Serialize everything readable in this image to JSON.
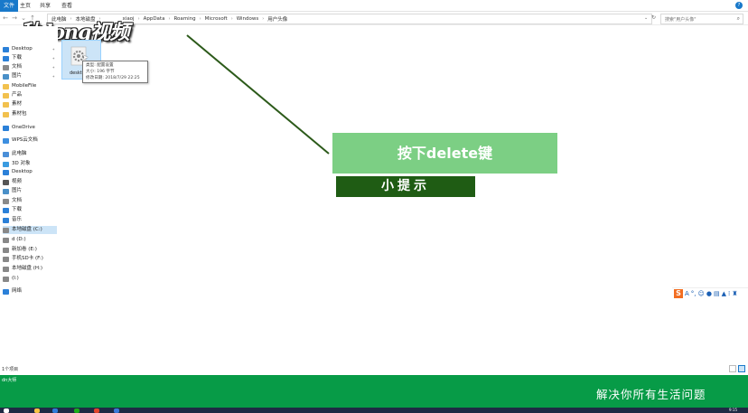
{
  "ribbon": {
    "tabs": [
      {
        "label": "文件",
        "active": true
      },
      {
        "label": "主页",
        "active": false
      },
      {
        "label": "共享",
        "active": false
      },
      {
        "label": "查看",
        "active": false
      }
    ],
    "help_glyph": "?"
  },
  "address": {
    "crumbs": [
      "本地磁盘",
      "xiaoj",
      "AppData",
      "Roaming",
      "Microsoft",
      "Windows",
      "用户头像"
    ],
    "leading_crumb": "此电脑",
    "search_placeholder": "搜索\"用户头像\""
  },
  "logo_text": "秋dong视频",
  "nav": {
    "items": [
      {
        "label": "Desktop",
        "icon": "desktop-icon",
        "pinned": true
      },
      {
        "label": "下载",
        "icon": "download-icon",
        "pinned": true
      },
      {
        "label": "文档",
        "icon": "document-icon",
        "pinned": true
      },
      {
        "label": "图片",
        "icon": "pictures-icon",
        "pinned": true
      },
      {
        "label": "MobileFile",
        "icon": "folder-icon",
        "pinned": false
      },
      {
        "label": "产品",
        "icon": "folder-icon",
        "pinned": false
      },
      {
        "label": "素材",
        "icon": "folder-icon",
        "pinned": false
      },
      {
        "label": "素材包",
        "icon": "folder-icon",
        "pinned": false
      },
      {
        "label": "OneDrive",
        "icon": "onedrive-icon",
        "pinned": false
      },
      {
        "label": "WPS云文档",
        "icon": "cloud-icon",
        "pinned": false
      },
      {
        "label": "此电脑",
        "icon": "computer-icon",
        "pinned": false
      },
      {
        "label": "3D 对象",
        "icon": "3d-objects-icon",
        "pinned": false
      },
      {
        "label": "Desktop",
        "icon": "desktop-icon",
        "pinned": false
      },
      {
        "label": "视频",
        "icon": "video-icon",
        "pinned": false
      },
      {
        "label": "图片",
        "icon": "pictures-icon",
        "pinned": false
      },
      {
        "label": "文档",
        "icon": "document-icon",
        "pinned": false
      },
      {
        "label": "下载",
        "icon": "download-icon",
        "pinned": false
      },
      {
        "label": "音乐",
        "icon": "music-icon",
        "pinned": false
      },
      {
        "label": "本地磁盘 (C:)",
        "icon": "drive-icon",
        "pinned": false,
        "selected": true
      },
      {
        "label": "d (D:)",
        "icon": "drive-icon",
        "pinned": false
      },
      {
        "label": "新加卷 (E:)",
        "icon": "drive-icon",
        "pinned": false
      },
      {
        "label": "手机SD卡 (F:)",
        "icon": "drive-icon",
        "pinned": false
      },
      {
        "label": "本地磁盘 (H:)",
        "icon": "drive-icon",
        "pinned": false
      },
      {
        "label": "(I:)",
        "icon": "drive-icon",
        "pinned": false
      },
      {
        "label": "网络",
        "icon": "network-icon",
        "pinned": false
      }
    ]
  },
  "file": {
    "name": "deskto",
    "tooltip": {
      "type": "类型: 配置设置",
      "size": "大小: 196 字节",
      "modified": "修改日期: 2018/7/29 22:25"
    }
  },
  "hint": {
    "main": "按下delete键",
    "sub": "小提示"
  },
  "status": {
    "count": "1个项目"
  },
  "banner": {
    "small": "dn大师",
    "slogan": "解决你所有生活问题"
  },
  "taskbar": {
    "clock": "9:15"
  },
  "colors": {
    "accent": "#1979ca",
    "selection": "#cce4f7",
    "hint_main": "#7ccf84",
    "hint_sub": "#1f5c14",
    "banner": "#079b47"
  }
}
